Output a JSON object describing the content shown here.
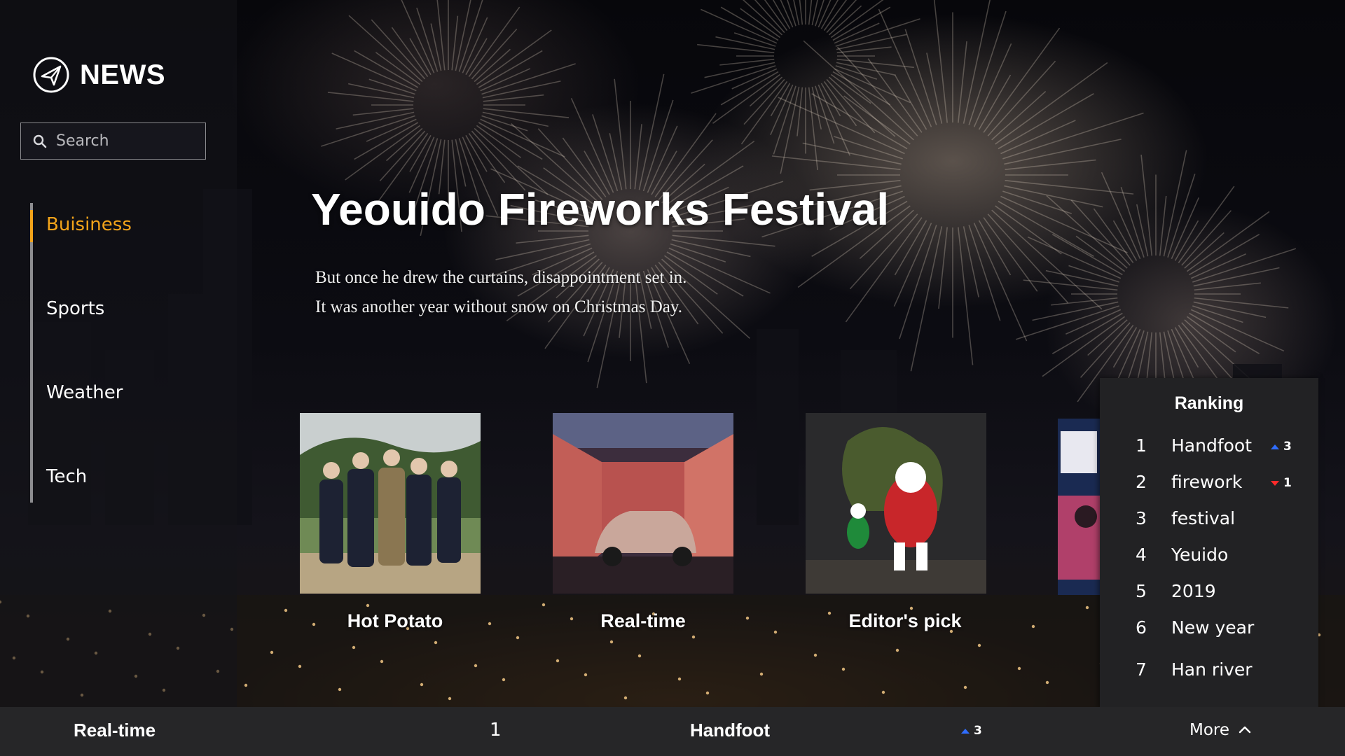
{
  "brand": {
    "name": "NEWS"
  },
  "search": {
    "placeholder": "Search"
  },
  "nav": {
    "items": [
      {
        "label": "Buisiness",
        "active": true
      },
      {
        "label": "Sports",
        "active": false
      },
      {
        "label": "Weather",
        "active": false
      },
      {
        "label": "Tech",
        "active": false
      }
    ]
  },
  "hero": {
    "title": "Yeouido Fireworks Festival",
    "lines": [
      "But once he drew the curtains, disappointment set in.",
      "It was another year without snow on Christmas Day."
    ]
  },
  "cards": [
    {
      "label": "Hot Potato"
    },
    {
      "label": "Real-time"
    },
    {
      "label": "Editor's pick"
    }
  ],
  "ranking": {
    "title": "Ranking",
    "items": [
      {
        "rank": "1",
        "word": "Handfoot",
        "change": "3",
        "direction": "up"
      },
      {
        "rank": "2",
        "word": "firework",
        "change": "1",
        "direction": "down"
      },
      {
        "rank": "3",
        "word": "festival"
      },
      {
        "rank": "4",
        "word": "Yeuido"
      },
      {
        "rank": "5",
        "word": "2019"
      },
      {
        "rank": "6",
        "word": "New year"
      },
      {
        "rank": "7",
        "word": "Han river"
      }
    ]
  },
  "bottom_bar": {
    "label": "Real-time",
    "rank": "1",
    "word": "Handfoot",
    "change": "3",
    "direction": "up",
    "more": "More"
  },
  "colors": {
    "accent": "#f2a31a",
    "up": "#2f6dff",
    "down": "#ff2a2a",
    "panel": "#222224",
    "bar": "#262628"
  }
}
